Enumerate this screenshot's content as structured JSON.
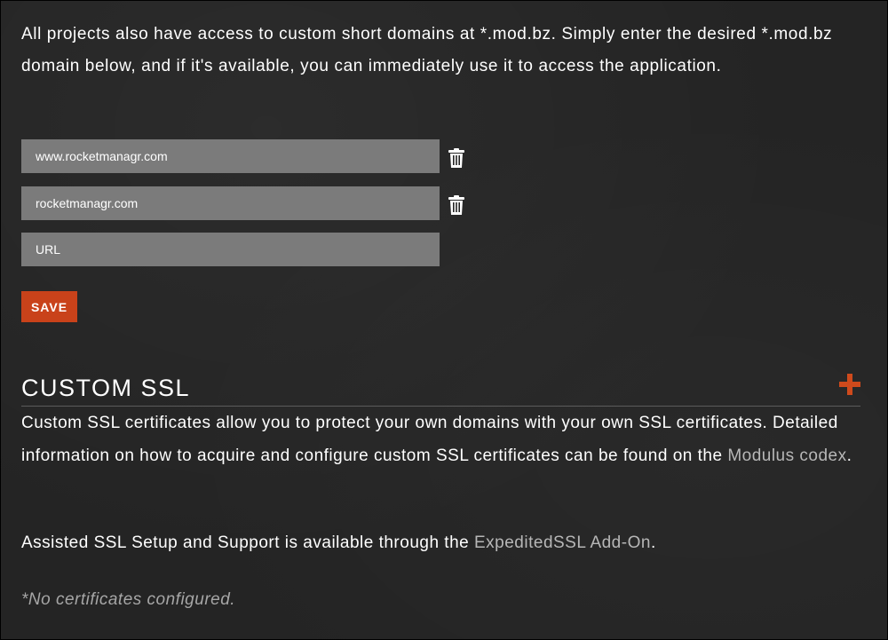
{
  "domains_section": {
    "intro_text": "All projects also have access to custom short domains at *.mod.bz. Simply enter the desired *.mod.bz domain below, and if it's available, you can immediately use it to access the application.",
    "domains": [
      {
        "value": "www.rocketmanagr.com",
        "delete_icon": "trash-icon"
      },
      {
        "value": "rocketmanagr.com",
        "delete_icon": "trash-icon"
      }
    ],
    "new_domain": {
      "value": "",
      "placeholder": "URL"
    },
    "save_label": "SAVE"
  },
  "ssl_section": {
    "title": "CUSTOM SSL",
    "add_icon": "plus-icon",
    "description_text": "Custom SSL certificates allow you to protect your own domains with your own SSL certificates. Detailed information on how to acquire and configure custom SSL certificates can be found on the ",
    "codex_link": "Modulus codex",
    "description_end": ".",
    "assisted_text": "Assisted SSL Setup and Support is available through the ",
    "addon_link": "ExpeditedSSL Add-On",
    "assisted_end": ".",
    "empty_message": "*No certificates configured."
  },
  "colors": {
    "background": "#242424",
    "input_background": "#7b7b7b",
    "accent": "#c9421a",
    "link": "#b7b7b7",
    "muted_text": "#a6a6a6"
  }
}
